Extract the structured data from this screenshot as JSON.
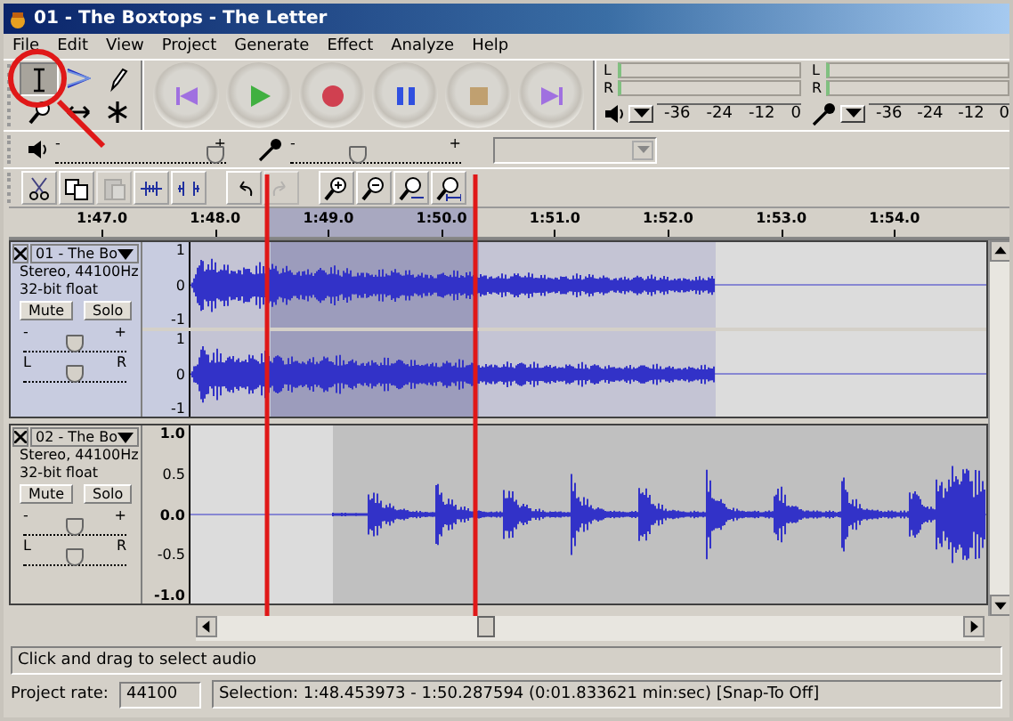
{
  "window": {
    "title": "01 - The Boxtops - The Letter"
  },
  "menu": [
    "File",
    "Edit",
    "View",
    "Project",
    "Generate",
    "Effect",
    "Analyze",
    "Help"
  ],
  "tools": [
    {
      "kind": "select",
      "selected": true
    },
    {
      "kind": "envelope",
      "selected": false
    },
    {
      "kind": "draw",
      "selected": false
    },
    {
      "kind": "zoom",
      "selected": false
    },
    {
      "kind": "timeshift",
      "selected": false
    },
    {
      "kind": "multi",
      "selected": false
    }
  ],
  "transport": [
    {
      "kind": "skip-start"
    },
    {
      "kind": "play"
    },
    {
      "kind": "record"
    },
    {
      "kind": "pause"
    },
    {
      "kind": "stop"
    },
    {
      "kind": "skip-end"
    }
  ],
  "meters": [
    {
      "kind": "playback",
      "channels": [
        "L",
        "R"
      ],
      "ticks": [
        "-36",
        "-24",
        "-12",
        "0"
      ]
    },
    {
      "kind": "recording",
      "channels": [
        "L",
        "R"
      ],
      "ticks": [
        "-36",
        "-24",
        "-12",
        "0"
      ]
    }
  ],
  "mixer": {
    "output": {
      "minus": "-",
      "plus": "+",
      "level": 0.94
    },
    "input": {
      "minus": "-",
      "plus": "+",
      "level": 0.4
    }
  },
  "edit_tools": [
    {
      "kind": "cut",
      "disabled": false
    },
    {
      "kind": "copy",
      "disabled": false
    },
    {
      "kind": "paste",
      "disabled": true
    },
    {
      "kind": "trim",
      "disabled": false
    },
    {
      "kind": "silence",
      "disabled": false
    },
    {
      "kind": "undo",
      "disabled": false
    },
    {
      "kind": "redo",
      "disabled": true
    },
    {
      "kind": "zoom-in",
      "disabled": false
    },
    {
      "kind": "zoom-out",
      "disabled": false
    },
    {
      "kind": "fit-selection",
      "disabled": false
    },
    {
      "kind": "fit-project",
      "disabled": false
    }
  ],
  "ruler": [
    "1:47.0",
    "1:48.0",
    "1:49.0",
    "1:50.0",
    "1:51.0",
    "1:52.0",
    "1:53.0",
    "1:54.0"
  ],
  "tracks": [
    {
      "name": "01 - The Bo",
      "selected": true,
      "format": "Stereo, 44100Hz",
      "sample": "32-bit float",
      "mute": "Mute",
      "solo": "Solo",
      "gain": {
        "minus": "-",
        "plus": "+",
        "level": 0.5
      },
      "pan": {
        "left": "L",
        "right": "R",
        "level": 0.5
      },
      "channels": [
        {
          "scale": [
            "1",
            "0",
            "-1"
          ]
        },
        {
          "scale": [
            "1",
            "0",
            "-1"
          ]
        }
      ]
    },
    {
      "name": "02 - The Bo",
      "selected": false,
      "format": "Stereo, 44100Hz",
      "sample": "32-bit float",
      "mute": "Mute",
      "solo": "Solo",
      "gain": {
        "minus": "-",
        "plus": "+",
        "level": 0.5
      },
      "pan": {
        "left": "L",
        "right": "R",
        "level": 0.5
      },
      "channels": [
        {
          "scale": [
            "1.0",
            "0.5",
            "0.0",
            "-0.5",
            "-1.0"
          ]
        }
      ]
    }
  ],
  "status": {
    "message": "Click and drag to select audio",
    "rate_label": "Project rate:",
    "rate": "44100",
    "selection": "Selection: 1:48.453973 - 1:50.287594 (0:01.833621 min:sec)  [Snap-To Off]"
  }
}
